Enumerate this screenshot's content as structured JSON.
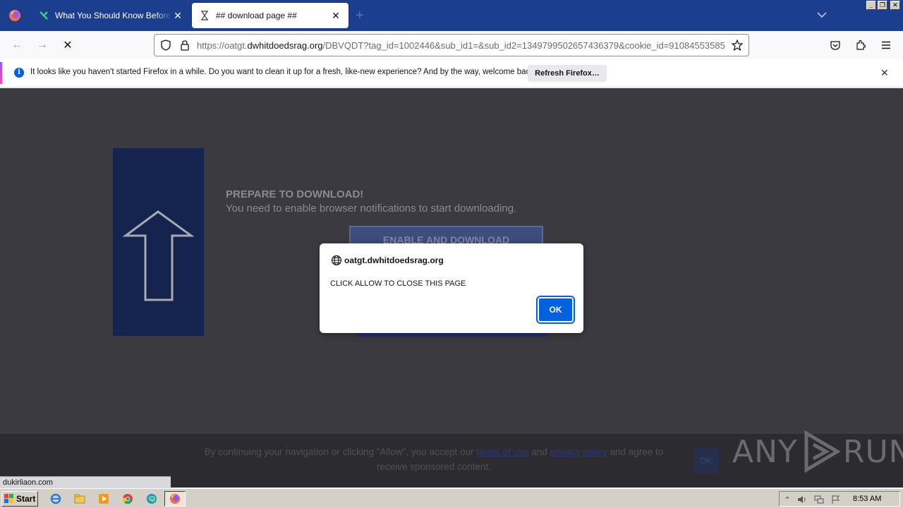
{
  "browser": {
    "tabs": [
      {
        "title": "What You Should Know Before Visit",
        "active": false
      },
      {
        "title": "## download page ##",
        "active": true
      }
    ],
    "url": {
      "prefix": "https://oatgt.",
      "host": "dwhitdoedsrag.org",
      "rest": "/DBVQDT?tag_id=1002446&sub_id1=&sub_id2=1349799502657436379&cookie_id=91084553585"
    },
    "notification": {
      "text": "It looks like you haven't started Firefox in a while. Do you want to clean it up for a fresh, like-new experience? And by the way, welcome back!",
      "button": "Refresh Firefox…"
    },
    "status_url": "dukirliaon.com"
  },
  "page": {
    "heading": "PREPARE TO DOWNLOAD!",
    "subheading": "You need to enable browser notifications to start downloading.",
    "enable_button": "ENABLE AND DOWNLOAD",
    "footer": {
      "text_before": "By continuing your navigation or clicking \"Allow\", you accept our",
      "terms_link": "terms of use",
      "and": "and",
      "privacy_link": "privacy policy",
      "text_after": "and agree to receive sponsored content.",
      "ok_button": "OK"
    },
    "watermark": {
      "left": "ANY",
      "right": "RUN"
    }
  },
  "dialog": {
    "host": "oatgt.dwhitdoedsrag.org",
    "message": "CLICK ALLOW TO CLOSE THIS PAGE",
    "ok": "OK"
  },
  "taskbar": {
    "start": "Start",
    "clock": "8:53 AM"
  },
  "colors": {
    "tabstrip": "#1c3e8e",
    "dialog_ok": "#0061e0",
    "page_bg": "#3a3a40"
  }
}
